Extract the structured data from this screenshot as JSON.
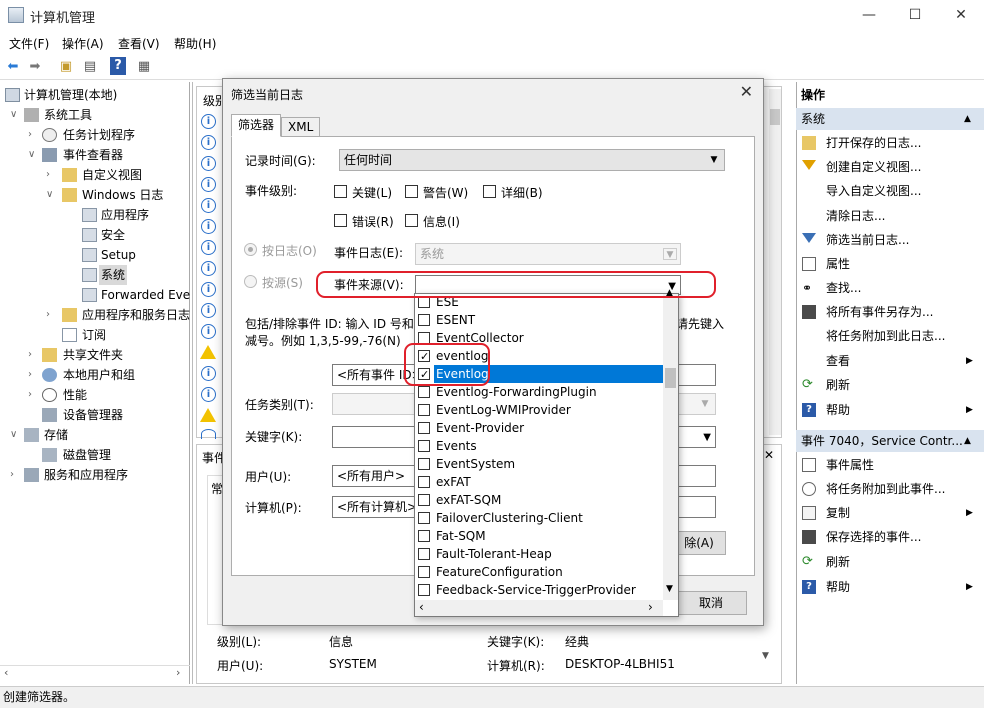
{
  "window": {
    "title": "计算机管理",
    "minimize": "—",
    "maximize": "☐",
    "close": "✕"
  },
  "menu": [
    "文件(F)",
    "操作(A)",
    "查看(V)",
    "帮助(H)"
  ],
  "tree": {
    "root": "计算机管理(本地)",
    "items": [
      "系统工具",
      "任务计划程序",
      "事件查看器",
      "自定义视图",
      "Windows 日志",
      "应用程序",
      "安全",
      "Setup",
      "系统",
      "Forwarded Eve",
      "应用程序和服务日志",
      "订阅",
      "共享文件夹",
      "本地用户和组",
      "性能",
      "设备管理器",
      "存储",
      "磁盘管理",
      "服务和应用程序"
    ]
  },
  "center": {
    "list_header": "级别",
    "detail_header": "事件",
    "detail_tab": "常",
    "detail_rows": [
      {
        "k1": "级别(L):",
        "v1": "信息",
        "k2": "关键字(K):",
        "v2": "经典"
      },
      {
        "k1": "用户(U):",
        "v1": "SYSTEM",
        "k2": "计算机(R):",
        "v2": "DESKTOP-4LBHI51"
      }
    ]
  },
  "actions": {
    "header": "操作",
    "section1": "系统",
    "items1": [
      "打开保存的日志...",
      "创建自定义视图...",
      "导入自定义视图...",
      "清除日志...",
      "筛选当前日志...",
      "属性",
      "查找...",
      "将所有事件另存为...",
      "将任务附加到此日志...",
      "查看",
      "刷新",
      "帮助"
    ],
    "section2": "事件 7040，Service Contr...",
    "items2": [
      "事件属性",
      "将任务附加到此事件...",
      "复制",
      "保存选择的事件...",
      "刷新",
      "帮助"
    ]
  },
  "status": "创建筛选器。",
  "dialog": {
    "title": "筛选当前日志",
    "tabs": [
      "筛选器",
      "XML"
    ],
    "logged_label": "记录时间(G):",
    "logged_value": "任何时间",
    "level_label": "事件级别:",
    "levels": [
      "关键(L)",
      "警告(W)",
      "详细(B)",
      "错误(R)",
      "信息(I)"
    ],
    "by_log_label": "按日志(O)",
    "event_logs_label": "事件日志(E):",
    "event_logs_value": "系统",
    "by_source_label": "按源(S)",
    "event_sources_label": "事件来源(V):",
    "include_text_1": "包括/排除事件 ID: 输入 ID 号和",
    "include_text_1b": "请先键入",
    "include_text_2": "减号。例如 1,3,5-99,-76(N)",
    "all_event_ids": "<所有事件 ID>",
    "task_category_label": "任务类别(T):",
    "keywords_label": "关键字(K):",
    "user_label": "用户(U):",
    "user_value": "<所有用户>",
    "computer_label": "计算机(P):",
    "computer_value": "<所有计算机>",
    "clear_button": "除(A)",
    "cancel_button": "取消"
  },
  "sources": [
    {
      "name": "ESE",
      "checked": false
    },
    {
      "name": "ESENT",
      "checked": false
    },
    {
      "name": "EventCollector",
      "checked": false
    },
    {
      "name": "eventlog",
      "checked": true
    },
    {
      "name": "Eventlog",
      "checked": true,
      "highlighted": true
    },
    {
      "name": "Eventlog-ForwardingPlugin",
      "checked": false
    },
    {
      "name": "EventLog-WMIProvider",
      "checked": false
    },
    {
      "name": "Event-Provider",
      "checked": false
    },
    {
      "name": "Events",
      "checked": false
    },
    {
      "name": "EventSystem",
      "checked": false
    },
    {
      "name": "exFAT",
      "checked": false
    },
    {
      "name": "exFAT-SQM",
      "checked": false
    },
    {
      "name": "FailoverClustering-Client",
      "checked": false
    },
    {
      "name": "Fat-SQM",
      "checked": false
    },
    {
      "name": "Fault-Tolerant-Heap",
      "checked": false
    },
    {
      "name": "FeatureConfiguration",
      "checked": false
    },
    {
      "name": "Feedback-Service-TriggerProvider",
      "checked": false
    }
  ],
  "colors": {
    "highlight": "#0078d7",
    "annotation": "#e0202b",
    "action_section": "#d9e3ef"
  }
}
